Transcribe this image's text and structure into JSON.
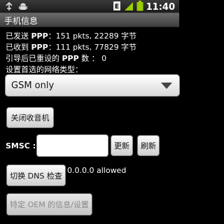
{
  "status_bar": {
    "time": "11:40",
    "icons": [
      "usb-debug-icon",
      "android-icon",
      "sim-icon",
      "signal-icon",
      "battery-icon"
    ],
    "sim_glyph": "E"
  },
  "title_bar": {
    "title": "手机信息"
  },
  "info": {
    "sent_label": "已发送 ",
    "sent_key": "PPP",
    "sent_value": "：151 pkts, 22289 字节",
    "received_label": "已收到 ",
    "received_key": "PPP",
    "received_value": "：111 pkts, 77829 字节",
    "reset_label": "引导后已重设的 ",
    "reset_key": "PPP",
    "reset_value": " 数 ： 0",
    "network_type_label": "设置首选的网络类型："
  },
  "network_spinner": {
    "selected": "GSM only"
  },
  "buttons": {
    "radio_off": "关闭收音机",
    "update": "更新",
    "refresh": "刷新",
    "dns_toggle": "切换 DNS 检查",
    "oem_info": "特定 OEM 的信息/设置"
  },
  "smsc": {
    "label": "SMSC :",
    "value": ""
  },
  "dns_status": "0.0.0.0 allowed",
  "colors": {
    "background": "#000000",
    "text": "#ffffff",
    "button_text": "#111111"
  }
}
